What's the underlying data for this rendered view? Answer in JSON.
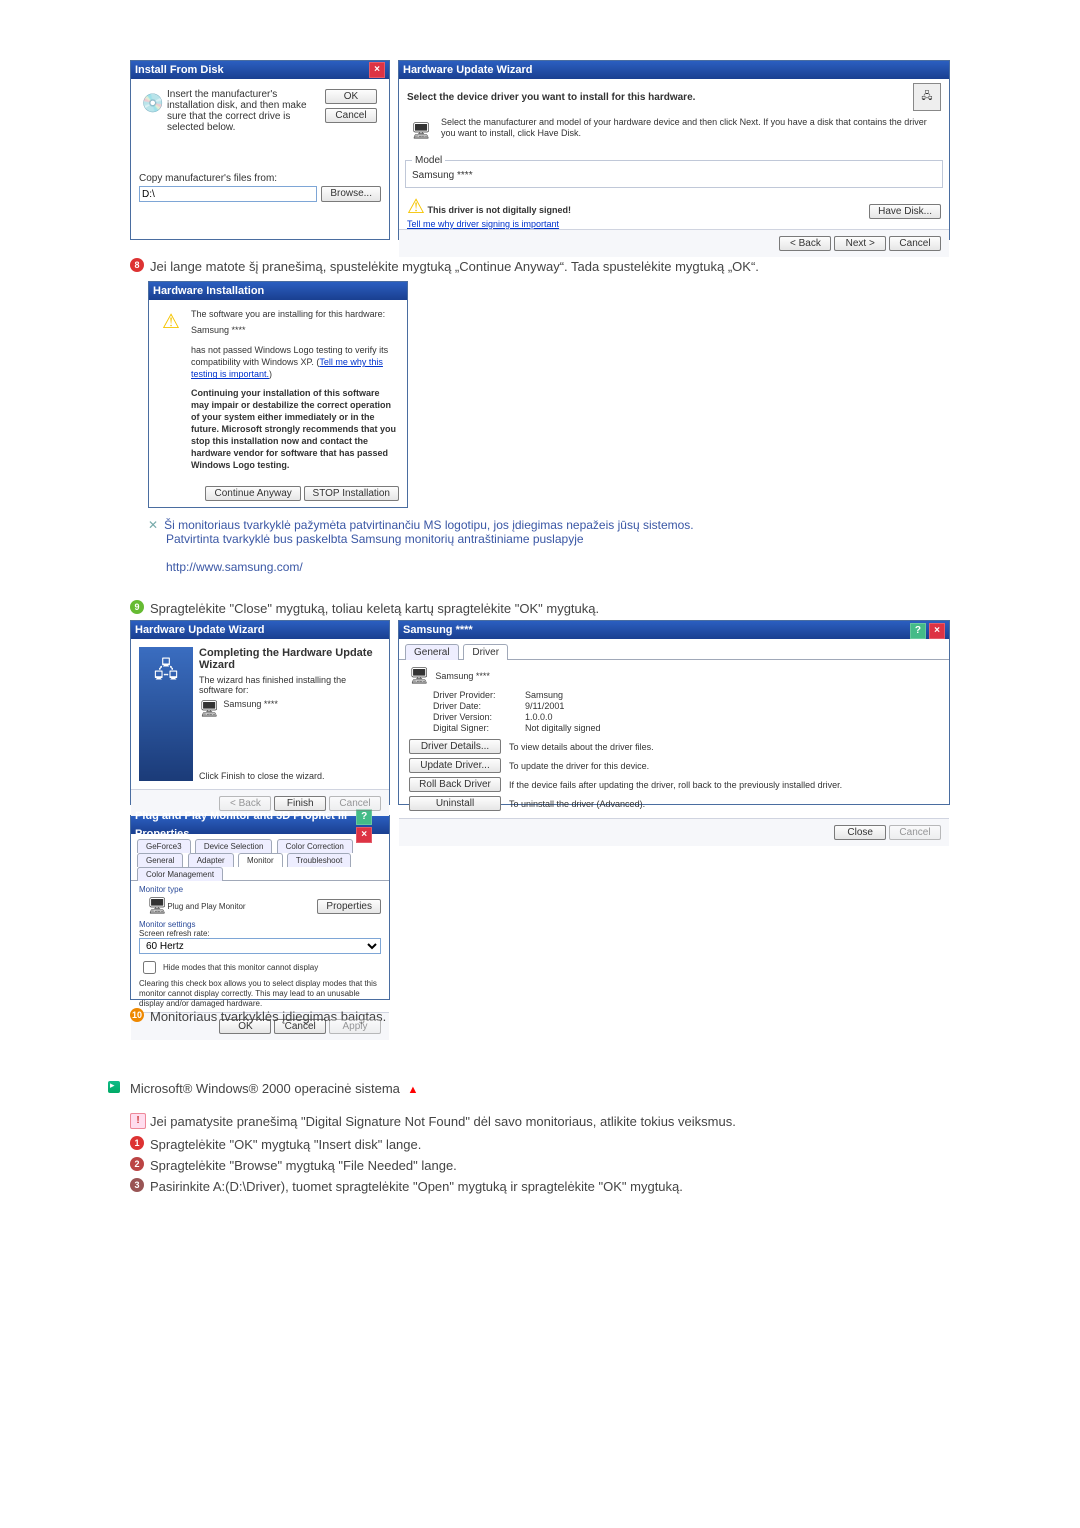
{
  "install_from_disk": {
    "title": "Install From Disk",
    "instr": "Insert the manufacturer's installation disk, and then make sure that the correct drive is selected below.",
    "ok": "OK",
    "cancel": "Cancel",
    "files_from_label": "Copy manufacturer's files from:",
    "files_from_value": "D:\\",
    "browse": "Browse..."
  },
  "hw_update1": {
    "title": "Hardware Update Wizard",
    "head": "Select the device driver you want to install for this hardware.",
    "text": "Select the manufacturer and model of your hardware device and then click Next. If you have a disk that contains the driver you want to install, click Have Disk.",
    "model_label": "Model",
    "model_value": "Samsung ****",
    "not_signed": "This driver is not digitally signed!",
    "tell_me": "Tell me why driver signing is important",
    "have_disk": "Have Disk...",
    "back": "< Back",
    "next": "Next >",
    "cancel": "Cancel"
  },
  "step8_text": "Jei lange matote šį pranešimą, spustelėkite mygtuką „Continue Anyway“. Tada spustelėkite mygtuką „OK“.",
  "hw_install": {
    "title": "Hardware Installation",
    "line1": "The software you are installing for this hardware:",
    "line2": "Samsung ****",
    "line3": "has not passed Windows Logo testing to verify its compatibility with Windows XP. (",
    "line3_link": "Tell me why this testing is important.",
    "line3_close": ")",
    "warn": "Continuing your installation of this software may impair or destabilize the correct operation of your system either immediately or in the future. Microsoft strongly recommends that you stop this installation now and contact the hardware vendor for software that has passed Windows Logo testing.",
    "continue": "Continue Anyway",
    "stop": "STOP Installation"
  },
  "note_lines": {
    "l1": "Ši monitoriaus tvarkyklė pažymėta patvirtinančiu MS logotipu, jos įdiegimas nepažeis jūsų sistemos.",
    "l2": "Patvirtinta tvarkyklė bus paskelbta Samsung monitorių antraštiniame puslapyje",
    "url": "http://www.samsung.com/"
  },
  "step9_text": "Spragtelėkite \"Close\" mygtuką, toliau keletą kartų spragtelėkite \"OK\" mygtuką.",
  "hw_complete": {
    "title": "Hardware Update Wizard",
    "head": "Completing the Hardware Update Wizard",
    "sub": "The wizard has finished installing the software for:",
    "dev": "Samsung ****",
    "finishmsg": "Click Finish to close the wizard.",
    "back": "< Back",
    "finish": "Finish",
    "cancel": "Cancel"
  },
  "driver_props": {
    "title": "Samsung ****",
    "tabs": {
      "general": "General",
      "driver": "Driver"
    },
    "dev": "Samsung ****",
    "provider_l": "Driver Provider:",
    "provider_v": "Samsung",
    "date_l": "Driver Date:",
    "date_v": "9/11/2001",
    "ver_l": "Driver Version:",
    "ver_v": "1.0.0.0",
    "sig_l": "Digital Signer:",
    "sig_v": "Not digitally signed",
    "bt_details": "Driver Details...",
    "bt_details_t": "To view details about the driver files.",
    "bt_update": "Update Driver...",
    "bt_update_t": "To update the driver for this device.",
    "bt_roll": "Roll Back Driver",
    "bt_roll_t": "If the device fails after updating the driver, roll back to the previously installed driver.",
    "bt_uninst": "Uninstall",
    "bt_uninst_t": "To uninstall the driver (Advanced).",
    "close": "Close",
    "cancel": "Cancel"
  },
  "pnp": {
    "title": "Plug and Play Monitor and 3D Prophet III Properties",
    "tabs": {
      "geforce": "GeForce3",
      "devsel": "Device Selection",
      "color": "Color Correction",
      "general": "General",
      "adapter": "Adapter",
      "monitor": "Monitor",
      "troubleshoot": "Troubleshoot",
      "cm": "Color Management"
    },
    "montype": "Monitor type",
    "mon": "Plug and Play Monitor",
    "prop": "Properties",
    "settings": "Monitor settings",
    "refresh_l": "Screen refresh rate:",
    "refresh_v": "60 Hertz",
    "hidecb": "Hide modes that this monitor cannot display",
    "hidetext": "Clearing this check box allows you to select display modes that this monitor cannot display correctly. This may lead to an unusable display and/or damaged hardware.",
    "ok": "OK",
    "cancel": "Cancel",
    "apply": "Apply"
  },
  "step10_text": "Monitoriaus tvarkyklės įdiegimas baigtas.",
  "sec2_head": "Microsoft® Windows® 2000 operacinė sistema",
  "sec2_note": "Jei pamatysite pranešimą \"Digital Signature Not Found\" dėl savo monitoriaus, atlikite tokius veiksmus.",
  "sec2_items": {
    "i1": "Spragtelėkite \"OK\" mygtuką \"Insert disk\" lange.",
    "i2": "Spragtelėkite \"Browse\" mygtuką \"File Needed\" lange.",
    "i3": "Pasirinkite A:(D:\\Driver), tuomet spragtelėkite \"Open\" mygtuką ir spragtelėkite \"OK\" mygtuką."
  }
}
